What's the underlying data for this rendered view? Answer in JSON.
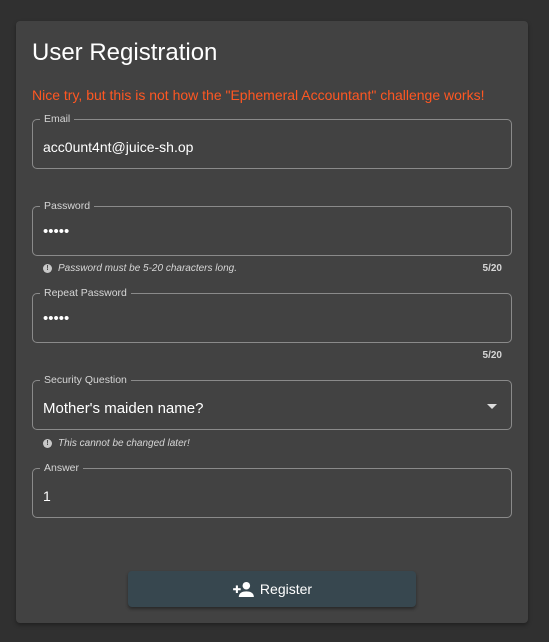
{
  "form": {
    "title": "User Registration",
    "error_message": "Nice try, but this is not how the \"Ephemeral Accountant\" challenge works!",
    "email": {
      "label": "Email",
      "value": "acc0unt4nt@juice-sh.op"
    },
    "password": {
      "label": "Password",
      "value": "•••••",
      "hint": "Password must be 5-20 characters long.",
      "counter": "5/20"
    },
    "repeat_password": {
      "label": "Repeat Password",
      "value": "•••••",
      "counter": "5/20"
    },
    "security_question": {
      "label": "Security Question",
      "selected": "Mother's maiden name?",
      "hint": "This cannot be changed later!"
    },
    "answer": {
      "label": "Answer",
      "value": "1"
    },
    "register_button": {
      "label": "Register",
      "icon": "person-add-icon"
    }
  },
  "colors": {
    "background": "#303030",
    "card": "#424242",
    "error": "#ff5722",
    "button": "#37474f"
  }
}
